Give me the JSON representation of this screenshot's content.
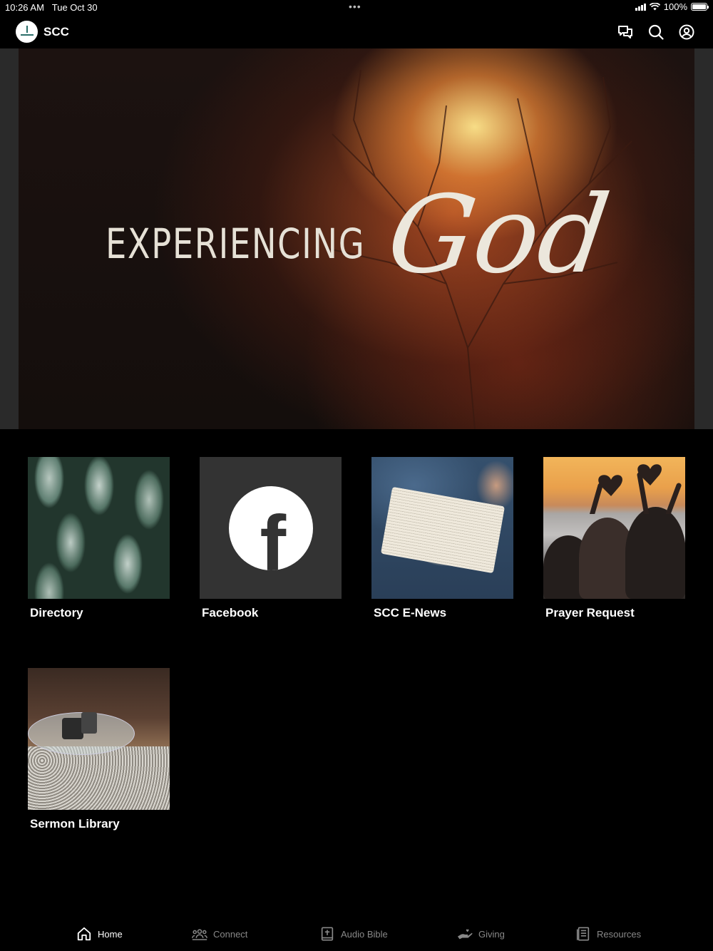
{
  "status_bar": {
    "time": "10:26 AM",
    "date": "Tue Oct 30",
    "dots": "•••",
    "battery": "100%"
  },
  "header": {
    "title": "SCC",
    "icons": [
      "chat-icon",
      "search-icon",
      "account-icon"
    ]
  },
  "hero": {
    "word1": "EXPERIENCING",
    "word2": "God"
  },
  "tiles": [
    {
      "label": "Directory"
    },
    {
      "label": "Facebook"
    },
    {
      "label": "SCC E-News"
    },
    {
      "label": "Prayer Request"
    },
    {
      "label": "Sermon Library"
    }
  ],
  "tabbar": {
    "tabs": [
      {
        "label": "Home",
        "icon": "home-icon",
        "active": true
      },
      {
        "label": "Connect",
        "icon": "people-icon",
        "active": false
      },
      {
        "label": "Audio Bible",
        "icon": "bible-icon",
        "active": false
      },
      {
        "label": "Giving",
        "icon": "giving-hand-icon",
        "active": false
      },
      {
        "label": "Resources",
        "icon": "resources-icon",
        "active": false
      }
    ]
  },
  "colors": {
    "background": "#000000",
    "tab_inactive": "#888888",
    "tab_active": "#ffffff",
    "facebook_tile": "#333333"
  }
}
